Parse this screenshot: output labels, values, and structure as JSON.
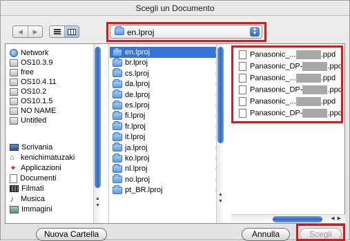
{
  "window": {
    "title": "Scegli un Documento"
  },
  "toolbar": {
    "back_icon": "back-arrow-icon",
    "forward_icon": "forward-arrow-icon",
    "list_view_icon": "list-view-icon",
    "column_view_icon": "column-view-icon",
    "location": "en.lproj",
    "stepper_glyph": "▲▼"
  },
  "sidebar": {
    "devices": [
      {
        "label": "Network",
        "icon": "network-globe-icon"
      },
      {
        "label": "OS10.3.9",
        "icon": "hard-disk-icon"
      },
      {
        "label": "free",
        "icon": "hard-disk-icon"
      },
      {
        "label": "OS10.4.11",
        "icon": "hard-disk-icon"
      },
      {
        "label": "OS10.2",
        "icon": "hard-disk-icon"
      },
      {
        "label": "OS10.1.5",
        "icon": "hard-disk-icon"
      },
      {
        "label": "NO NAME",
        "icon": "removable-disk-icon",
        "eject": "⏏"
      },
      {
        "label": "Untitled",
        "icon": "removable-disk-icon",
        "eject": "⏏"
      }
    ],
    "places": [
      {
        "label": "Scrivania",
        "icon": "desktop-icon"
      },
      {
        "label": "kenichimatuzaki",
        "icon": "home-icon"
      },
      {
        "label": "Applicazioni",
        "icon": "applications-icon"
      },
      {
        "label": "Documenti",
        "icon": "documents-icon"
      },
      {
        "label": "Filmati",
        "icon": "movies-icon"
      },
      {
        "label": "Musica",
        "icon": "music-icon"
      },
      {
        "label": "Immagini",
        "icon": "pictures-icon"
      }
    ]
  },
  "folders": {
    "items": [
      "en.lproj",
      "br.lproj",
      "cs.lproj",
      "da.lproj",
      "de.lproj",
      "es.lproj",
      "fi.lproj",
      "fr.lproj",
      "it.lproj",
      "ja.lproj",
      "ko.lproj",
      "nl.lproj",
      "no.lproj",
      "pt_BR.lproj"
    ],
    "selected_index": 0,
    "disclosure": "▶"
  },
  "files": {
    "items": [
      {
        "prefix": "Panasonic_...",
        "suffix": ".ppd"
      },
      {
        "prefix": "Panasonic_DP-",
        "suffix": ".ppd"
      },
      {
        "prefix": "Panasonic_...",
        "suffix": ".ppd"
      },
      {
        "prefix": "Panasonic_DP-",
        "suffix": ".ppd"
      },
      {
        "prefix": "Panasonic_...",
        "suffix": ".ppd"
      },
      {
        "prefix": "Panasonic_DP-",
        "suffix": ".ppd"
      }
    ]
  },
  "buttons": {
    "new_folder": "Nuova Cartella",
    "cancel": "Annulla",
    "choose": "Scegli"
  },
  "colors": {
    "highlight": "#e0141b",
    "selection": "#3874d8",
    "scroll_thumb": "#2f67c4"
  }
}
